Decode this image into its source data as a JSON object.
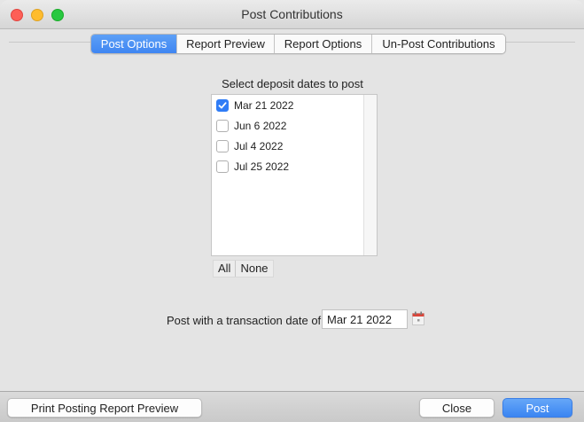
{
  "window": {
    "title": "Post Contributions"
  },
  "tabs": [
    {
      "label": "Post Options",
      "active": true
    },
    {
      "label": "Report Preview",
      "active": false
    },
    {
      "label": "Report Options",
      "active": false
    },
    {
      "label": "Un-Post Contributions",
      "active": false
    }
  ],
  "deposits": {
    "heading": "Select deposit dates to post",
    "items": [
      {
        "date": "Mar 21 2022",
        "checked": true
      },
      {
        "date": "Jun 6 2022",
        "checked": false
      },
      {
        "date": "Jul 4 2022",
        "checked": false
      },
      {
        "date": "Jul 25 2022",
        "checked": false
      }
    ],
    "select_all_label": "All",
    "select_none_label": "None"
  },
  "transaction": {
    "label": "Post with a transaction date of:",
    "date_value": "Mar 21 2022"
  },
  "footer": {
    "print_preview_label": "Print Posting Report Preview",
    "close_label": "Close",
    "post_label": "Post"
  },
  "colors": {
    "accent": "#3f86f2",
    "close_dot": "#fd5f57",
    "minimize_dot": "#febc2e",
    "zoom_dot": "#28c840"
  }
}
